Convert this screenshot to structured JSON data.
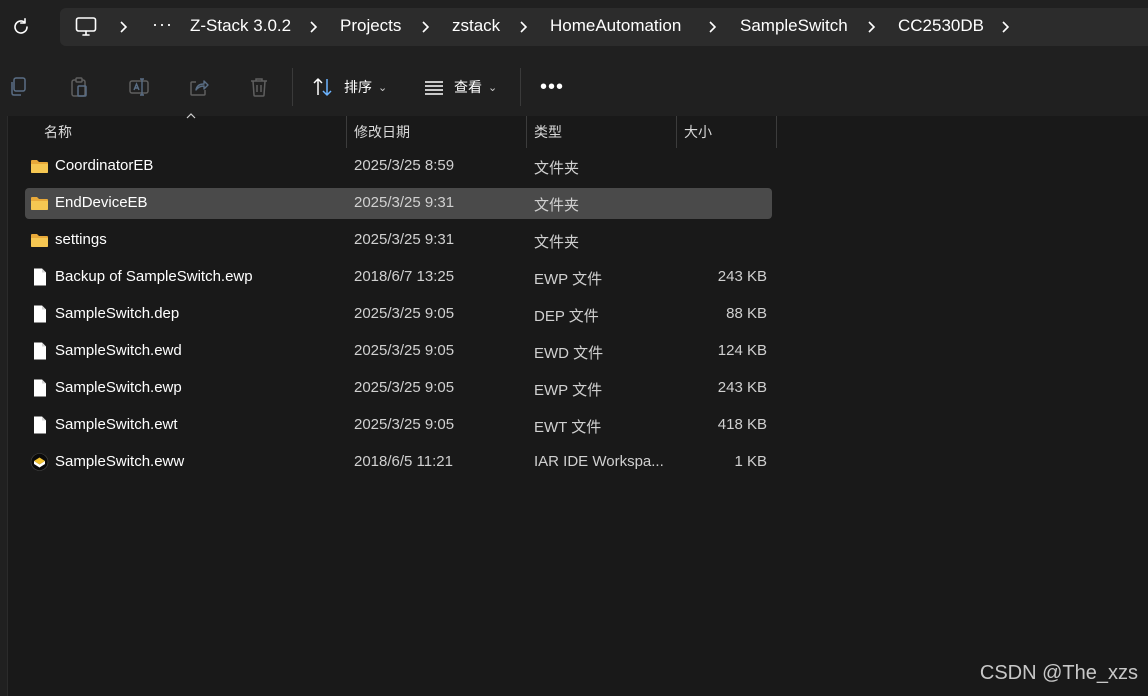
{
  "address_bar": {
    "refresh_icon": "refresh-icon",
    "computer_icon": "computer-icon",
    "overflow": "···",
    "breadcrumbs": [
      "Z-Stack 3.0.2",
      "Projects",
      "zstack",
      "HomeAutomation",
      "SampleSwitch",
      "CC2530DB"
    ]
  },
  "toolbar": {
    "icons": [
      "copy-icon",
      "paste-icon",
      "rename-icon",
      "share-icon",
      "delete-icon"
    ],
    "sort_label": "排序",
    "view_label": "查看",
    "more_label": "•••"
  },
  "columns": {
    "name": "名称",
    "modified": "修改日期",
    "type": "类型",
    "size": "大小",
    "sorted_by": "name"
  },
  "files": [
    {
      "name": "CoordinatorEB",
      "modified": "2025/3/25 8:59",
      "type": "文件夹",
      "size": "",
      "icon": "folder-icon",
      "selected": false
    },
    {
      "name": "EndDeviceEB",
      "modified": "2025/3/25 9:31",
      "type": "文件夹",
      "size": "",
      "icon": "folder-icon",
      "selected": true
    },
    {
      "name": "settings",
      "modified": "2025/3/25 9:31",
      "type": "文件夹",
      "size": "",
      "icon": "folder-icon",
      "selected": false
    },
    {
      "name": "Backup of SampleSwitch.ewp",
      "modified": "2018/6/7 13:25",
      "type": "EWP 文件",
      "size": "243 KB",
      "icon": "file-icon",
      "selected": false
    },
    {
      "name": "SampleSwitch.dep",
      "modified": "2025/3/25 9:05",
      "type": "DEP 文件",
      "size": "88 KB",
      "icon": "file-icon",
      "selected": false
    },
    {
      "name": "SampleSwitch.ewd",
      "modified": "2025/3/25 9:05",
      "type": "EWD 文件",
      "size": "124 KB",
      "icon": "file-icon",
      "selected": false
    },
    {
      "name": "SampleSwitch.ewp",
      "modified": "2025/3/25 9:05",
      "type": "EWP 文件",
      "size": "243 KB",
      "icon": "file-icon",
      "selected": false
    },
    {
      "name": "SampleSwitch.ewt",
      "modified": "2025/3/25 9:05",
      "type": "EWT 文件",
      "size": "418 KB",
      "icon": "file-icon",
      "selected": false
    },
    {
      "name": "SampleSwitch.eww",
      "modified": "2018/6/5 11:21",
      "type": "IAR IDE Workspa...",
      "size": "1 KB",
      "icon": "iar-workspace-icon",
      "selected": false
    }
  ],
  "watermark": "CSDN @The_xzs",
  "colors": {
    "background": "#191919",
    "chrome": "#202020",
    "address_bg": "#2c2c2c",
    "selected_row": "#4a4a4a",
    "folder": "#f3c04c"
  }
}
